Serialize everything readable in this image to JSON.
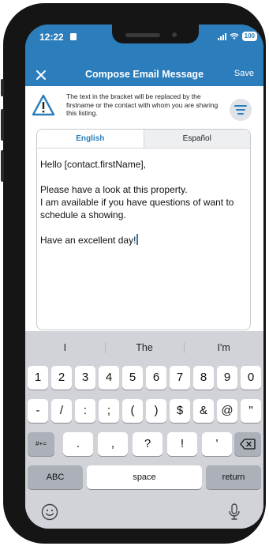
{
  "status": {
    "time": "12:22",
    "battery": "100"
  },
  "header": {
    "title": "Compose Email Message",
    "save_label": "Save"
  },
  "info": {
    "text": "The text in the bracket will be replaced by the firstname or the contact with whom you are sharing this listing."
  },
  "tabs": [
    {
      "label": "English",
      "active": true
    },
    {
      "label": "Español",
      "active": false
    }
  ],
  "editor": {
    "lines": [
      "Hello [contact.firstName],",
      "Please have a look at this property.",
      "I am available if you have questions of want to schedule a showing.",
      "Have an excellent day!"
    ]
  },
  "keyboard": {
    "suggestions": [
      "I",
      "The",
      "I'm"
    ],
    "row1": [
      "1",
      "2",
      "3",
      "4",
      "5",
      "6",
      "7",
      "8",
      "9",
      "0"
    ],
    "row2": [
      "-",
      "/",
      ":",
      ";",
      "(",
      ")",
      "$",
      "&",
      "@",
      "\""
    ],
    "row3_mode": "#+=",
    "row3": [
      ".",
      ",",
      "?",
      "!",
      "'"
    ],
    "abc": "ABC",
    "space": "space",
    "return": "return"
  },
  "colors": {
    "brand_blue": "#2c7dbb"
  },
  "icons": [
    "close-icon",
    "warning-icon",
    "filter-icon",
    "backspace-icon",
    "emoji-icon",
    "microphone-icon"
  ]
}
